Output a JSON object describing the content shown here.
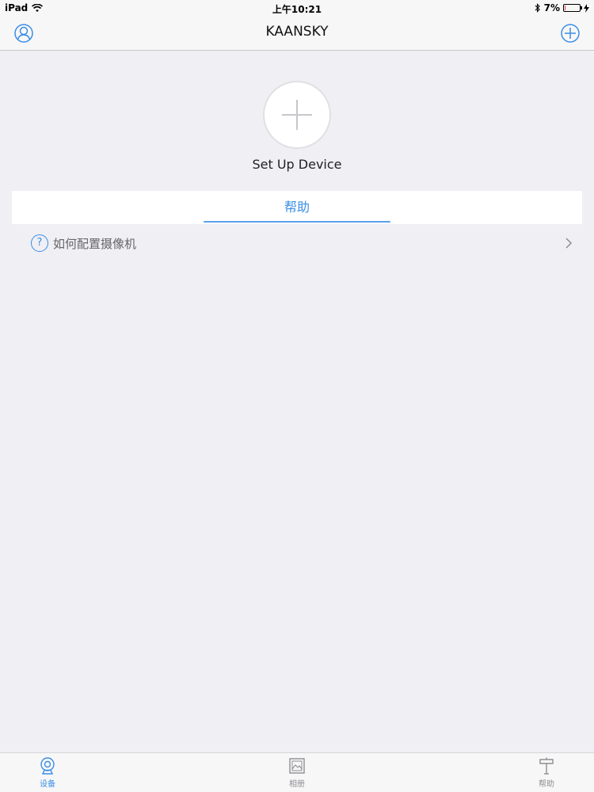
{
  "status_bar": {
    "device": "iPad",
    "time": "上午10:21",
    "battery_percent": "7%",
    "battery_level": 0.07
  },
  "nav": {
    "title": "KAANSKY"
  },
  "setup": {
    "label": "Set Up Device"
  },
  "help_section": {
    "tab_label": "帮助",
    "items": [
      {
        "label": "如何配置摄像机"
      }
    ]
  },
  "tab_bar": {
    "items": [
      {
        "label": "设备",
        "icon": "camera-icon",
        "active": true
      },
      {
        "label": "相册",
        "icon": "album-icon",
        "active": false
      },
      {
        "label": "帮助",
        "icon": "help-signpost-icon",
        "active": false
      }
    ]
  },
  "colors": {
    "accent": "#3a8ee6",
    "background": "#efeff4",
    "battery_low": "#e53935"
  }
}
